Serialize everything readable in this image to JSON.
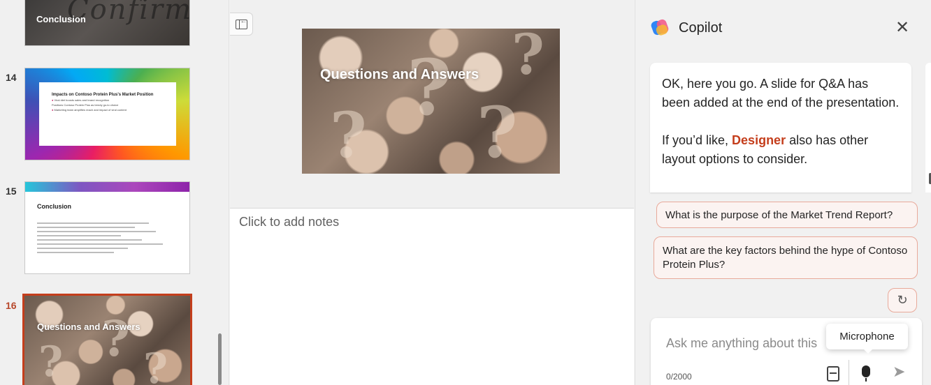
{
  "thumbnails": {
    "slide13": {
      "title": "Conclusion",
      "script_text": "Confirm"
    },
    "slide14": {
      "number": "14",
      "heading": "Impacts on Contoso Protein Plus's Market Position",
      "lines": [
        "Viral diet boosts sales and brand recognition",
        "Positions Contoso Protein Plus as trendy go-to choice",
        "Marketing team amplifies reach and impact of viral content"
      ]
    },
    "slide15": {
      "number": "15",
      "heading": "Conclusion"
    },
    "slide16": {
      "number": "16",
      "title": "Questions and Answers"
    }
  },
  "main": {
    "slide_title": "Questions and Answers",
    "notes_placeholder": "Click to add notes"
  },
  "copilot": {
    "title": "Copilot",
    "close_label": "✕",
    "message_p1": "OK, here you go. A slide for Q&A has been added at the end of the presentation.",
    "message_p2_before": "If you’d like, ",
    "message_p2_link": "Designer",
    "message_p2_after": " also has other layout options to consider.",
    "suggestions": [
      "What is the purpose of the Market Trend Report?",
      "What are the key factors behind the hype of Contoso Protein Plus?"
    ],
    "refresh_label": "↻",
    "input_placeholder": "Ask me anything about this",
    "char_count": "0/2000",
    "send_label": "➤",
    "tooltip": "Microphone"
  },
  "colors": {
    "accent": "#c43e1c",
    "suggestion_border": "#e8a99a"
  }
}
